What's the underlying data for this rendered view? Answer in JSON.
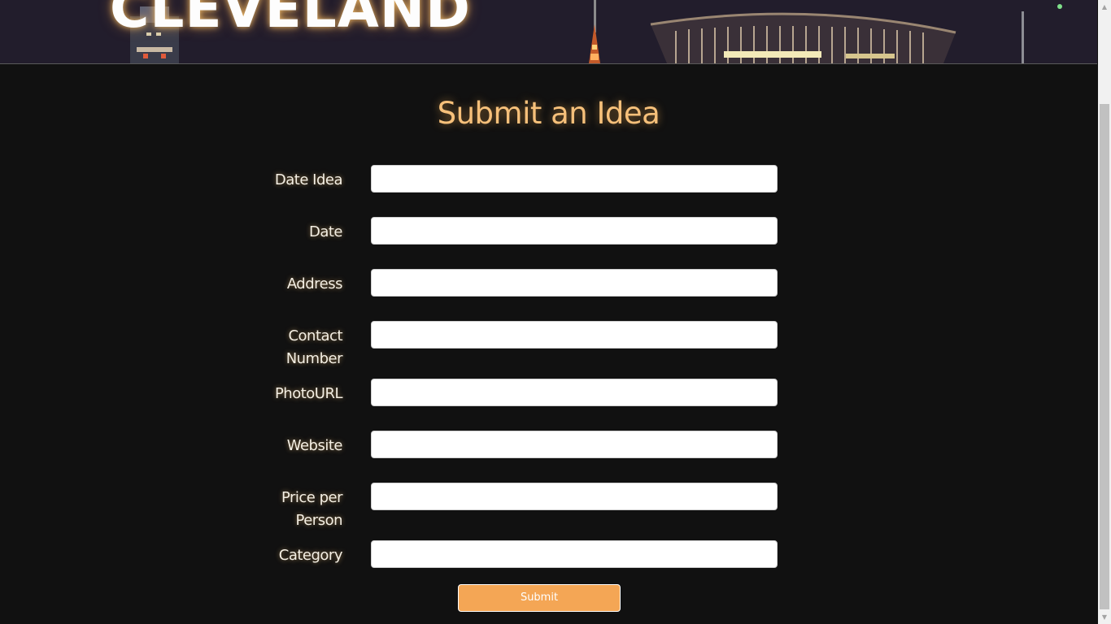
{
  "header": {
    "brand": "CLEVELAND"
  },
  "page": {
    "title": "Submit an Idea"
  },
  "form": {
    "fields": [
      {
        "label": "Date Idea",
        "value": ""
      },
      {
        "label": "Date",
        "value": ""
      },
      {
        "label": "Address",
        "value": ""
      },
      {
        "label": "Contact Number",
        "value": ""
      },
      {
        "label": "PhotoURL",
        "value": ""
      },
      {
        "label": "Website",
        "value": ""
      },
      {
        "label": "Price per Person",
        "value": ""
      },
      {
        "label": "Category",
        "value": ""
      }
    ],
    "submit_label": "Submit"
  },
  "colors": {
    "background": "#111111",
    "title": "#f6c07a",
    "submit_button": "#f4a655",
    "label_text": "#f4efe4"
  },
  "icons": {
    "scroll_up": "scroll-up-icon",
    "scroll_down": "scroll-down-icon"
  }
}
